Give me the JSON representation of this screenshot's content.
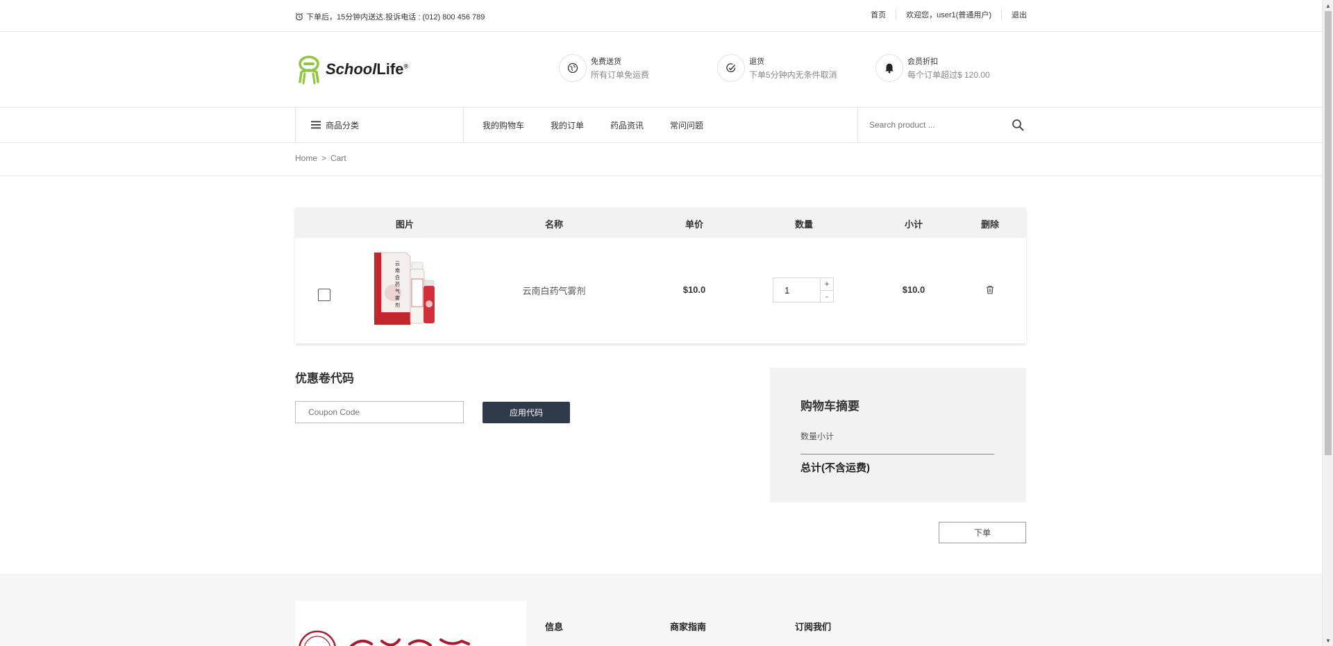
{
  "topbar": {
    "notice": "下单后，15分钟内送达.投诉电话 : (012) 800 456 789",
    "links": [
      "首页",
      "欢迎您，user1(普通用户)",
      "退出"
    ]
  },
  "header": {
    "logo_text_bold": "School",
    "logo_text_light": "Life",
    "logo_reg": "®",
    "features": [
      {
        "title": "免费送货",
        "desc": "所有订单免运费"
      },
      {
        "title": "退货",
        "desc": "下单5分钟内无条件取消"
      },
      {
        "title": "会员折扣",
        "desc": "每个订单超过$ 120.00"
      }
    ]
  },
  "nav": {
    "category": "商品分类",
    "menu": [
      "我的购物车",
      "我的订单",
      "药品资讯",
      "常问问题"
    ],
    "search_placeholder": "Search product ..."
  },
  "breadcrumb": {
    "home": "Home",
    "sep": ">",
    "current": "Cart"
  },
  "cart": {
    "headers": {
      "image": "图片",
      "name": "名称",
      "price": "单价",
      "qty": "数量",
      "subtotal": "小计",
      "delete": "删除"
    },
    "items": [
      {
        "name": "云南白药气雾剂",
        "price": "$10.0",
        "qty": "1",
        "subtotal": "$10.0",
        "box_text": "云南白药气雾剂"
      }
    ]
  },
  "coupon": {
    "title": "优惠卷代码",
    "placeholder": "Coupon Code",
    "apply": "应用代码"
  },
  "summary": {
    "title": "购物车摘要",
    "qty_subtotal": "数量小计",
    "total": "总计(不含运费)"
  },
  "order_button": "下单",
  "footer": {
    "cols": [
      "信息",
      "商家指南",
      "订阅我们"
    ]
  },
  "colors": {
    "accent": "#8dc63f",
    "dark_button": "#2f3a4a",
    "panel_bg": "#f2f2f2"
  }
}
